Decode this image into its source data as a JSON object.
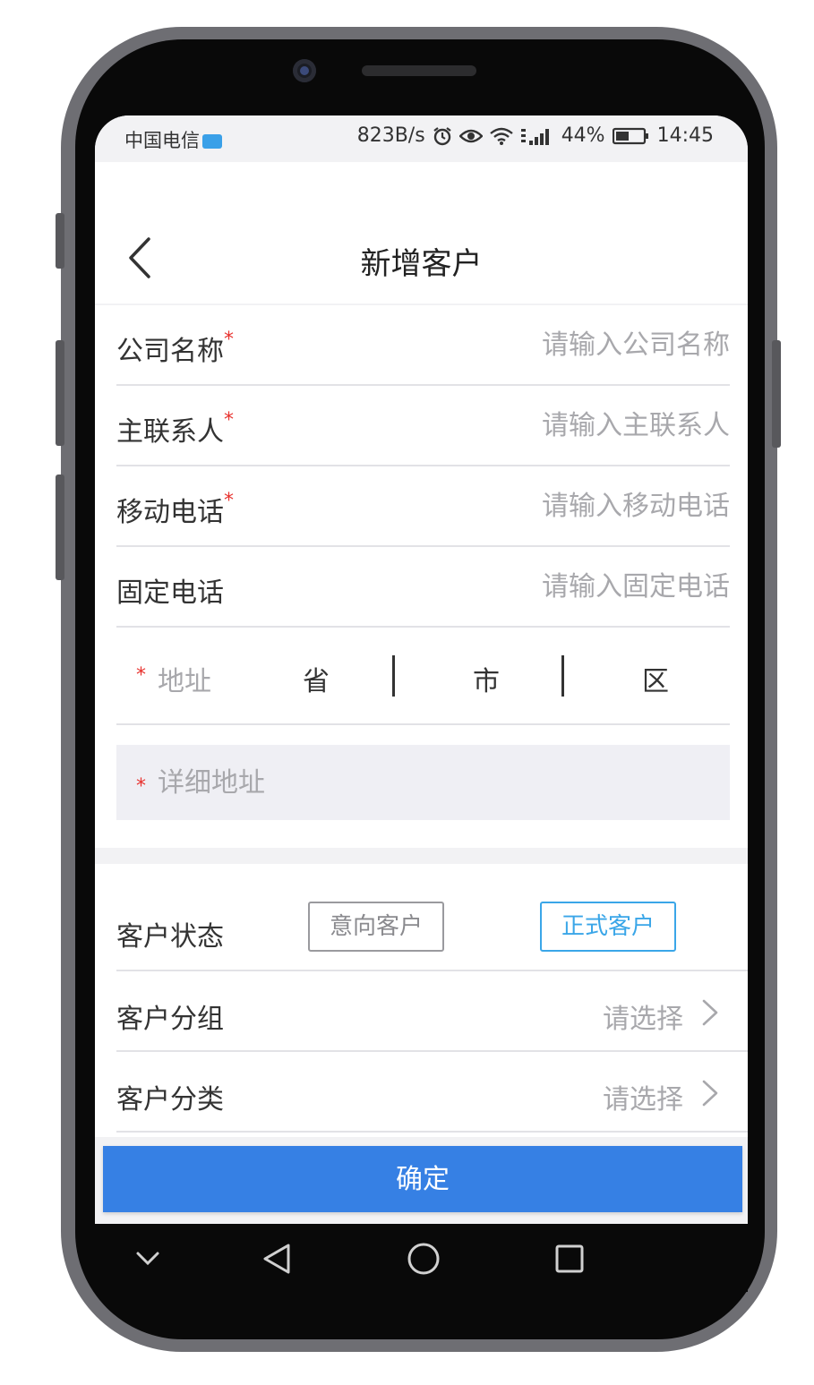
{
  "status_bar": {
    "carrier": "中国电信",
    "net_speed": "823B/s",
    "battery": "44%",
    "time": "14:45"
  },
  "header": {
    "title": "新增客户",
    "back_icon": "chevron-left-icon"
  },
  "form": {
    "company": {
      "label": "公司名称",
      "required_mark": "*",
      "placeholder": "请输入公司名称"
    },
    "contact": {
      "label": "主联系人",
      "required_mark": "*",
      "placeholder": "请输入主联系人"
    },
    "mobile": {
      "label": "移动电话",
      "required_mark": "*",
      "placeholder": "请输入移动电话"
    },
    "landline": {
      "label": "固定电话",
      "placeholder": "请输入固定电话"
    },
    "address": {
      "required_mark": "*",
      "label": "地址",
      "province": "省",
      "city": "市",
      "district": "区"
    },
    "detail_address": {
      "required_mark": "*",
      "placeholder": "详细地址"
    }
  },
  "customer": {
    "status_label": "客户状态",
    "status_options": [
      "意向客户",
      "正式客户"
    ],
    "selected_status": "正式客户",
    "group": {
      "label": "客户分组",
      "value": "请选择"
    },
    "category": {
      "label": "客户分类",
      "value": "请选择"
    }
  },
  "confirm_label": "确定",
  "colors": {
    "primary": "#3680e4",
    "active_outline": "#3aa6e8",
    "required": "#e8322e"
  }
}
